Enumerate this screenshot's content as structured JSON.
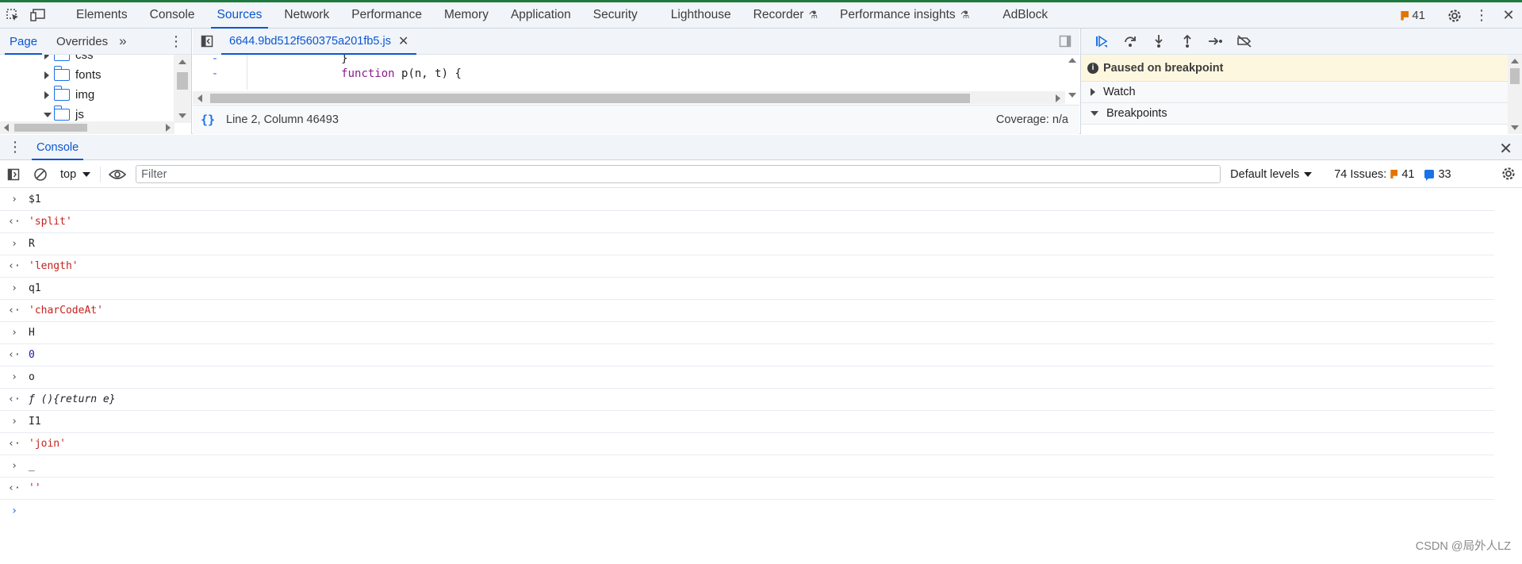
{
  "main_tabs": [
    {
      "label": "Elements"
    },
    {
      "label": "Console"
    },
    {
      "label": "Sources"
    },
    {
      "label": "Network"
    },
    {
      "label": "Performance"
    },
    {
      "label": "Memory"
    },
    {
      "label": "Application"
    },
    {
      "label": "Security"
    },
    {
      "label": "Lighthouse"
    },
    {
      "label": "Recorder"
    },
    {
      "label": "Performance insights"
    },
    {
      "label": "AdBlock"
    }
  ],
  "active_tab": "Sources",
  "issues_count": "41",
  "navigator": {
    "tabs": [
      "Page",
      "Overrides"
    ],
    "tree": [
      {
        "label": "css",
        "expanded": false
      },
      {
        "label": "fonts",
        "expanded": false
      },
      {
        "label": "img",
        "expanded": false
      },
      {
        "label": "js",
        "expanded": true
      }
    ]
  },
  "editor": {
    "file_tab": "6644.9bd512f560375a201fb5.js",
    "lines": [
      {
        "gutter": "-",
        "code": "            }"
      },
      {
        "gutter": "-",
        "keyword": "function",
        "code": " p(n, t) {"
      }
    ],
    "status_position": "Line 2, Column 46493",
    "coverage": "Coverage: n/a"
  },
  "debugger": {
    "paused_text": "Paused on breakpoint",
    "sections": [
      "Watch",
      "Breakpoints"
    ]
  },
  "drawer": {
    "tab": "Console"
  },
  "console_toolbar": {
    "context": "top",
    "filter_placeholder": "Filter",
    "levels": "Default levels",
    "issues_label": "74 Issues:",
    "warnings": "41",
    "info": "33"
  },
  "console_rows": [
    {
      "kind": "input",
      "text": "$1"
    },
    {
      "kind": "output",
      "type": "str",
      "text": "'split'"
    },
    {
      "kind": "input",
      "text": "R"
    },
    {
      "kind": "output",
      "type": "str",
      "text": "'length'"
    },
    {
      "kind": "input",
      "text": "q1"
    },
    {
      "kind": "output",
      "type": "str",
      "text": "'charCodeAt'"
    },
    {
      "kind": "input",
      "text": "H"
    },
    {
      "kind": "output",
      "type": "num",
      "text": "0"
    },
    {
      "kind": "input",
      "text": "o"
    },
    {
      "kind": "output",
      "type": "fn",
      "text": "ƒ (){return e}"
    },
    {
      "kind": "input",
      "text": "I1"
    },
    {
      "kind": "output",
      "type": "str",
      "text": "'join'"
    },
    {
      "kind": "input",
      "text": "_"
    },
    {
      "kind": "output",
      "type": "str",
      "text": "''"
    }
  ],
  "watermark": "CSDN @局外人LZ"
}
